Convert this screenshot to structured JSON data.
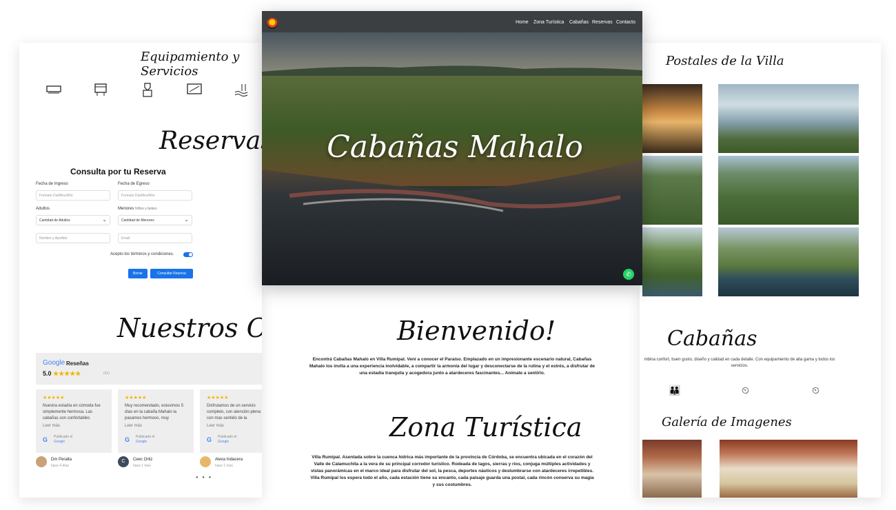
{
  "equipamiento": {
    "title": "Equipamiento y Servicios",
    "icons": [
      "air-conditioner-icon",
      "grill-icon",
      "barbecue-icon",
      "tv-icon",
      "pool-icon"
    ]
  },
  "reservas": {
    "title": "Reservas",
    "form_title": "Consulta por tu Reserva",
    "fecha_ingreso_label": "Fecha de Ingreso",
    "fecha_ingreso_placeholder": "Formato Dia/Mes/Año",
    "fecha_egreso_label": "Fecha de Egreso",
    "fecha_egreso_placeholder": "Formato Dia/Mes/Año",
    "adultos_label": "Adultos",
    "adultos_value": "Cantidad de Adultos",
    "menores_label": "Menores",
    "menores_hint": "Niños y bebes",
    "menores_value": "Cantidad de Menores",
    "nombre_placeholder": "Nombre y Apellido",
    "email_placeholder": "Email",
    "terms_label": "Acepto los términos y condiciones.",
    "borrar_label": "Borrar",
    "consultar_label": "Consultar Reserva"
  },
  "clientes": {
    "title": "Nuestros Clientes",
    "google_word": "Google",
    "resenas_label": "Reseñas",
    "rating": "5.0",
    "stars": "★★★★★",
    "count": "(41)",
    "reviews": [
      {
        "stars": "★★★★★",
        "text": "Nuestra estadía en cómoda fue simplemente hermosa. Las cabañas son confortables",
        "more": "Leer más",
        "posted": "Publicado el",
        "source": "Google"
      },
      {
        "stars": "★★★★★",
        "text": "Muy recomendado, estuvimos 5 días en la cabaña Mahalo la pasamos hermoso, muy",
        "more": "Leer más",
        "posted": "Publicado el",
        "source": "Google"
      },
      {
        "stars": "★★★★★",
        "text": "Disfrutamos de un servicio completo, con atención plena y con mas sentido de la",
        "more": "Leer más",
        "posted": "Publicado el",
        "source": "Google"
      }
    ],
    "reviewers": [
      {
        "name": "Dm Peralta",
        "ago": "hace 4 días",
        "initial": ""
      },
      {
        "name": "Ceec Ortiz",
        "ago": "hace 1 mes",
        "initial": "C"
      },
      {
        "name": "Alexa Indacera",
        "ago": "hace 1 mes",
        "initial": ""
      }
    ],
    "dots": "● ● ●"
  },
  "hero": {
    "title": "Cabañas Mahalo",
    "nav": [
      "Home",
      "Zona Turística",
      "Cabañas",
      "Reservas",
      "Contacto"
    ]
  },
  "bienvenido": {
    "title": "Bienvenido!",
    "text": "Encontrá Cabañas Mahalo en Villa Rumipal. Vení a conocer el Paraíso. Emplazado en un impresionante escenario natural, Cabañas Mahalo los invita a una experiencia inolvidable, a compartir la armonía del lugar y desconectarse de la rutina y el estrés, a disfrutar de una estadía tranquila y acogedora junto a atardeceres fascinantes... Animate a sentirlo."
  },
  "zona": {
    "title": "Zona Turística",
    "text": "Villa Rumipal. Asentada sobre la cuenca hídrica más importante de la provincia de Córdoba, se encuentra ubicada en el corazón del Valle de Calamuchita a la vera de su principal corredor turístico. Rodeada de lagos, sierras y ríos, conjuga múltiples actividades y vistas panorámicas en el marco ideal para disfrutar del sol, la pesca, deportes náuticos y deslumbrarse con atardeceres irrepetibles. Villa Rumipal los espera todo el año, cada estación tiene su encanto, cada paisaje guarda una postal, cada rincón conserva su magia y sus costumbres."
  },
  "postales": {
    "title": "Postales de la Villa"
  },
  "cabanas": {
    "title": "Cabañas",
    "text": "mbina confort, buen gusto, diseño y calidad en cada detalle. Con equipamiento de alta gama y todos los servicios.",
    "icons": [
      "family-icon",
      "dining-icon",
      "kitchen-icon"
    ]
  },
  "galeria": {
    "title": "Galería de Imagenes"
  },
  "colors": {
    "accent": "#1a73e8",
    "star": "#f4b400",
    "navbar": "#3b3f41",
    "whatsapp": "#25d366"
  }
}
